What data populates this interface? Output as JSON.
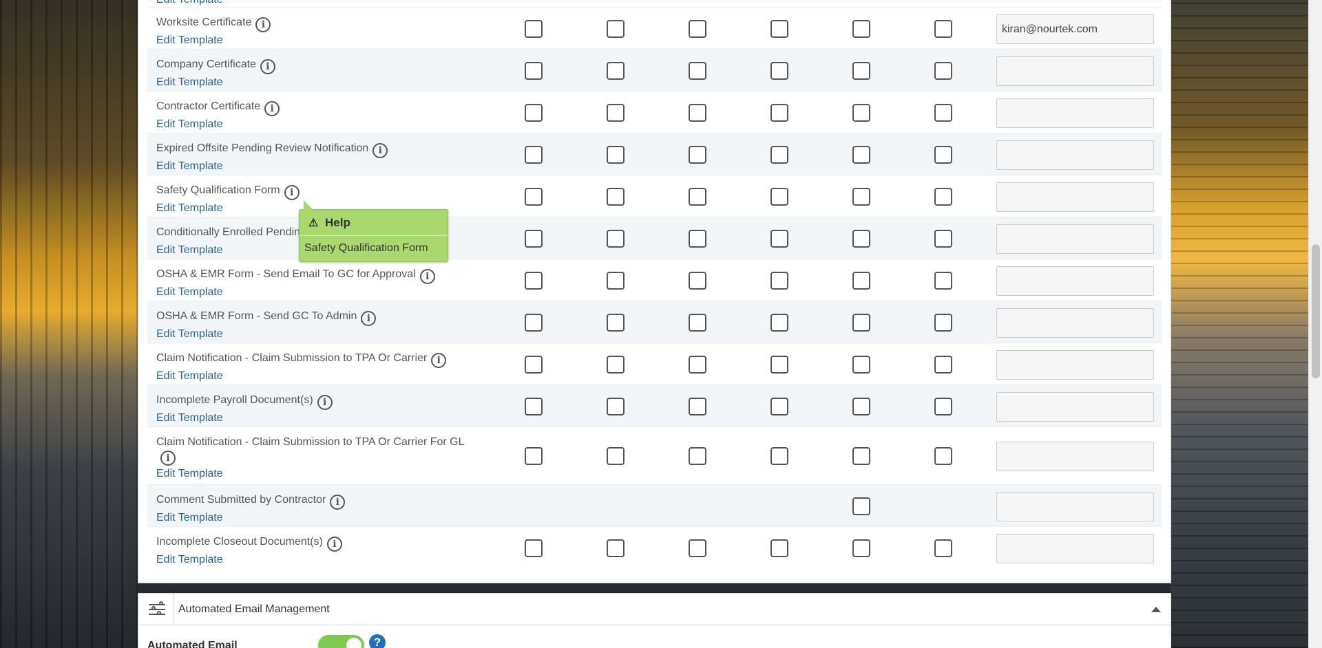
{
  "truncated_row": {
    "edit_label": "Edit Template"
  },
  "rows": [
    {
      "name": "Worksite Certificate",
      "edit_label": "Edit Template",
      "email": "kiran@nourtek.com"
    },
    {
      "name": "Company Certificate",
      "edit_label": "Edit Template",
      "email": ""
    },
    {
      "name": "Contractor Certificate",
      "edit_label": "Edit Template",
      "email": ""
    },
    {
      "name": "Expired Offsite Pending Review Notification",
      "edit_label": "Edit Template",
      "email": ""
    },
    {
      "name": "Safety Qualification Form",
      "edit_label": "Edit Template",
      "email": ""
    },
    {
      "name": "Conditionally Enrolled Pending Review",
      "edit_label": "Edit Template",
      "email": ""
    },
    {
      "name": "OSHA & EMR Form - Send Email To GC for Approval",
      "edit_label": "Edit Template",
      "email": ""
    },
    {
      "name": "OSHA & EMR Form - Send GC To Admin",
      "edit_label": "Edit Template",
      "email": ""
    },
    {
      "name": "Claim Notification - Claim Submission to TPA Or Carrier",
      "edit_label": "Edit Template",
      "email": ""
    },
    {
      "name": "Incomplete Payroll Document(s)",
      "edit_label": "Edit Template",
      "email": ""
    },
    {
      "name": "Claim Notification - Claim Submission to TPA Or Carrier For GL",
      "edit_label": "Edit Template",
      "email": ""
    },
    {
      "name": "Comment Submitted by Contractor",
      "edit_label": "Edit Template",
      "email": ""
    },
    {
      "name": "Incomplete Closeout Document(s)",
      "edit_label": "Edit Template",
      "email": ""
    }
  ],
  "info_glyph": "i",
  "tooltip": {
    "title": "Help",
    "body": "Safety Qualification Form",
    "icon": "warning-icon",
    "warn_glyph": "⚠"
  },
  "section": {
    "title": "Automated Email Management",
    "field_label": "Automated Email",
    "toggle_on": true,
    "help_glyph": "?"
  },
  "colors": {
    "link": "#2a6496",
    "tooltip_bg": "#a9d86e",
    "toggle_on": "#7ec950",
    "help_icon": "#1f6fc2"
  }
}
